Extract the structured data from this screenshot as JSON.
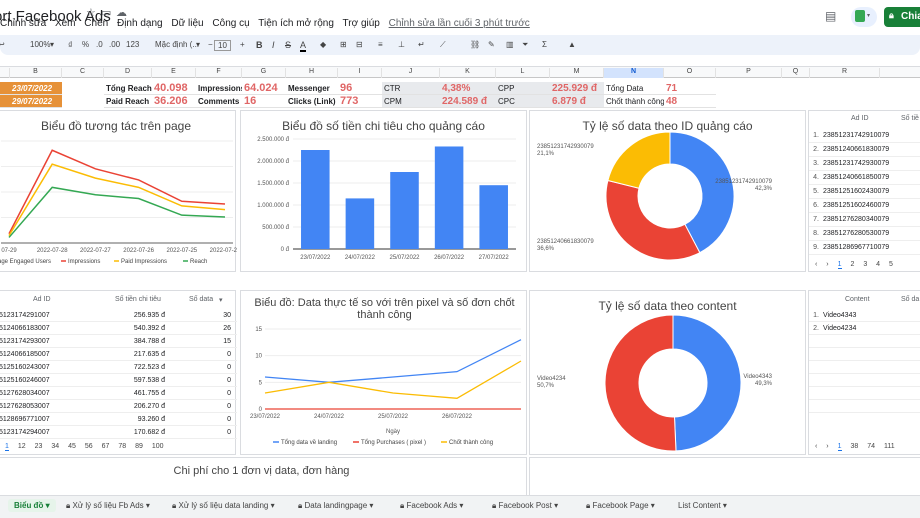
{
  "app": {
    "doc_title": "ort Facebook Ads",
    "menu": [
      "Chỉnh sửa",
      "Xem",
      "Chèn",
      "Định dạng",
      "Dữ liệu",
      "Công cụ",
      "Tiện ích mở rộng",
      "Trợ giúp"
    ],
    "last_edit": "Chỉnh sửa lần cuối 3 phút trước",
    "share_label": "Chia"
  },
  "toolbar": {
    "zoom": "100%",
    "currency": "₫",
    "percent": "%",
    "dec1": ".0",
    "dec2": ".00",
    "numfmt": "123",
    "font": "Mặc định (...",
    "size": "10"
  },
  "columns": [
    "B",
    "C",
    "D",
    "E",
    "F",
    "G",
    "H",
    "I",
    "J",
    "K",
    "L",
    "M",
    "N",
    "O",
    "P",
    "Q",
    "R"
  ],
  "metrics": {
    "date_from": "23/07/2022",
    "date_to": "29/07/2022",
    "tong_reach_label": "Tổng Reach",
    "tong_reach": "40.098",
    "paid_reach_label": "Paid Reach",
    "paid_reach": "36.206",
    "impressions_label": "Impressions",
    "impressions": "64.024",
    "comments_label": "Comments",
    "comments": "16",
    "messenger_label": "Messenger",
    "messenger": "96",
    "clicks_label": "Clicks (Link)",
    "clicks": "773",
    "ctr_label": "CTR",
    "ctr": "4,38%",
    "cpm_label": "CPM",
    "cpm": "224.589 đ",
    "cpp_label": "CPP",
    "cpp": "225.929 đ",
    "cpc_label": "CPC",
    "cpc": "6.879 đ",
    "tong_data_label": "Tổng Data",
    "tong_data": "71",
    "chot_label": "Chốt thành công",
    "chot": "48"
  },
  "chart1": {
    "title": "Biểu đồ tương tác trên page",
    "categories": [
      "07-29",
      "2022-07-28",
      "2022-07-27",
      "2022-07-26",
      "2022-07-25",
      "2022-07-24"
    ],
    "legend": [
      "age Engaged Users",
      "Impressions",
      "Paid Impressions",
      "Reach"
    ],
    "colors": [
      "#ea4335",
      "#ea4335",
      "#fbbc04",
      "#34a853"
    ]
  },
  "chart2": {
    "title": "Biểu đồ số tiền chi tiêu cho quảng cáo",
    "yticks": [
      "2.500.000 đ",
      "2.000.000 đ",
      "1.500.000 đ",
      "1.000.000 đ",
      "500.000 đ",
      "0 đ"
    ]
  },
  "chart_data": [
    {
      "type": "line",
      "title": "Biểu đồ tương tác trên page",
      "categories": [
        "07-29",
        "2022-07-28",
        "2022-07-27",
        "2022-07-26",
        "2022-07-25",
        "2022-07-24"
      ],
      "series": [
        {
          "name": "Impressions",
          "values": [
            10,
            100,
            80,
            68,
            45,
            42
          ]
        },
        {
          "name": "Paid Impressions",
          "values": [
            8,
            85,
            70,
            60,
            40,
            36
          ]
        },
        {
          "name": "Reach",
          "values": [
            6,
            60,
            52,
            48,
            30,
            28
          ]
        }
      ]
    },
    {
      "type": "bar",
      "title": "Biểu đồ số tiền chi tiêu cho quảng cáo",
      "categories": [
        "23/07/2022",
        "24/07/2022",
        "25/07/2022",
        "26/07/2022",
        "27/07/2022"
      ],
      "values": [
        2250000,
        1150000,
        1750000,
        2330000,
        1450000
      ],
      "ylim": [
        0,
        2500000
      ],
      "color": "#4285f4"
    },
    {
      "type": "pie",
      "title": "Tỷ lệ số data theo ID quảng cáo",
      "labels": [
        "23851231742910079",
        "23851240661830079",
        "23851231742930079"
      ],
      "values": [
        42.3,
        36.6,
        21.1
      ],
      "label_texts": [
        "42,3%",
        "36,6%",
        "21,1%"
      ],
      "colors": [
        "#4285f4",
        "#ea4335",
        "#fbbc04"
      ]
    },
    {
      "type": "line",
      "title": "Biểu đồ: Data thực tế so với trên pixel và số đơn chốt thành công",
      "xlabel": "Ngày",
      "categories": [
        "23/07/2022",
        "24/07/2022",
        "25/07/2022",
        "26/07/2022",
        ""
      ],
      "ylim": [
        0,
        15
      ],
      "yticks": [
        "15",
        "10",
        "5",
        "0"
      ],
      "series": [
        {
          "name": "Tổng data về landing",
          "values": [
            6,
            5,
            6,
            7,
            13
          ]
        },
        {
          "name": "Tổng Purchases ( pixel )",
          "values": [
            0,
            0,
            0,
            0,
            0
          ]
        },
        {
          "name": "Chốt thành công",
          "values": [
            3,
            5,
            3,
            2,
            9
          ]
        }
      ],
      "colors": [
        "#4285f4",
        "#ea4335",
        "#fbbc04"
      ]
    },
    {
      "type": "pie",
      "title": "Tỷ lệ số data theo content",
      "labels": [
        "Video4343",
        "Video4234"
      ],
      "values": [
        49.3,
        50.7
      ],
      "label_texts": [
        "49,3%",
        "50,7%"
      ],
      "colors": [
        "#4285f4",
        "#ea4335"
      ]
    }
  ],
  "table_right_top": {
    "header": [
      "Ad ID",
      "Số tiề"
    ],
    "rows": [
      "23851231742910079",
      "23851240661830079",
      "23851231742930079",
      "23851240661850079",
      "23851251602430079",
      "23851251602460079",
      "23851276280340079",
      "23851276280530079",
      "23851286967710079"
    ],
    "pager": [
      "1",
      "2",
      "3",
      "4",
      "5"
    ]
  },
  "table_left": {
    "header": [
      "Ad ID",
      "Số tiền chi tiêu",
      "Số data"
    ],
    "rows": [
      [
        "5123174291007",
        "256.935 đ",
        "30"
      ],
      [
        "5124066183007",
        "540.392 đ",
        "26"
      ],
      [
        "5123174293007",
        "384.788 đ",
        "15"
      ],
      [
        "5124066185007",
        "217.635 đ",
        "0"
      ],
      [
        "5125160243007",
        "722.523 đ",
        "0"
      ],
      [
        "5125160246007",
        "597.538 đ",
        "0"
      ],
      [
        "5127628034007",
        "461.755 đ",
        "0"
      ],
      [
        "5127628053007",
        "206.270 đ",
        "0"
      ],
      [
        "5128696771007",
        "93.260 đ",
        "0"
      ],
      [
        "5123174294007",
        "170.682 đ",
        "0"
      ]
    ],
    "pager": [
      "1",
      "12",
      "23",
      "34",
      "45",
      "56",
      "67",
      "78",
      "89",
      "100"
    ]
  },
  "table_right_bottom": {
    "header": [
      "Content",
      "Số da"
    ],
    "rows": [
      "Video4343",
      "Video4234"
    ],
    "pager": [
      "1",
      "38",
      "74",
      "111"
    ]
  },
  "bottom_chart_title": "Chi phí cho 1 đơn vị data, đơn hàng",
  "tabs": [
    "Biểu đồ",
    "Xử lý số liệu Fb Ads",
    "Xử lý số liệu data landing",
    "Data landingpage",
    "Facebook Ads",
    "Facebook Post",
    "Facebook Page",
    "List Content"
  ]
}
